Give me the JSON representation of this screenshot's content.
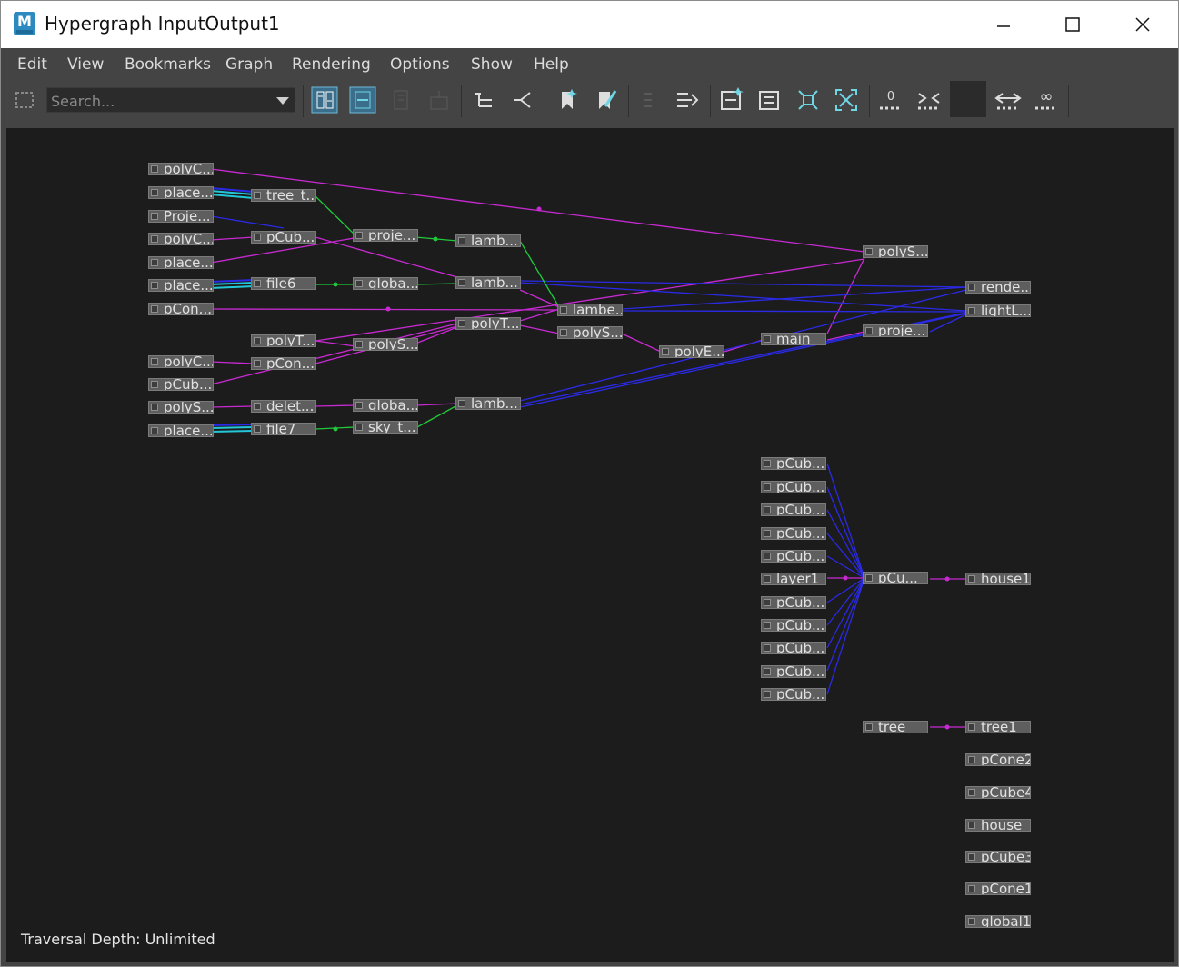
{
  "window": {
    "title": "Hypergraph InputOutput1",
    "app_icon_letter": "M",
    "controls": {
      "minimize": "—",
      "maximize": "☐",
      "close": "✕"
    }
  },
  "menu": [
    "Edit",
    "View",
    "Bookmarks",
    "Graph",
    "Rendering",
    "Options",
    "Show",
    "Help"
  ],
  "toolbar": {
    "search_placeholder": "Search...",
    "buttons": [
      "freeform-layout",
      "scene-hierarchy",
      "graph-layout",
      "hierarchy-layout",
      "input-connections",
      "output-connections",
      "create-bookmark",
      "edit-bookmark",
      "collapse",
      "expand",
      "frame-selection",
      "frame-branch",
      "frame-all",
      "frame-hierarchy",
      "depth-zero",
      "decrease-depth",
      "increase-depth",
      "unlimited-depth"
    ]
  },
  "graph": {
    "nodes": [
      {
        "id": "n1",
        "label": "polyC..."
      },
      {
        "id": "n2",
        "label": "place..."
      },
      {
        "id": "n3",
        "label": "tree_t..."
      },
      {
        "id": "n4",
        "label": "Proje..."
      },
      {
        "id": "n5",
        "label": "polyC..."
      },
      {
        "id": "n6",
        "label": "pCub..."
      },
      {
        "id": "n7",
        "label": "proje..."
      },
      {
        "id": "n8",
        "label": "lamb..."
      },
      {
        "id": "n9",
        "label": "place..."
      },
      {
        "id": "n10",
        "label": "polyS..."
      },
      {
        "id": "n11",
        "label": "place..."
      },
      {
        "id": "n12",
        "label": "file6"
      },
      {
        "id": "n13",
        "label": "globa..."
      },
      {
        "id": "n14",
        "label": "lamb..."
      },
      {
        "id": "n15",
        "label": "rende..."
      },
      {
        "id": "n16",
        "label": "pCon..."
      },
      {
        "id": "n17",
        "label": "lambe..."
      },
      {
        "id": "n18",
        "label": "lightL..."
      },
      {
        "id": "n19",
        "label": "polyT..."
      },
      {
        "id": "n20",
        "label": "polyT..."
      },
      {
        "id": "n21",
        "label": "polyS..."
      },
      {
        "id": "n22",
        "label": "main"
      },
      {
        "id": "n23",
        "label": "proje..."
      },
      {
        "id": "n24",
        "label": "polyS..."
      },
      {
        "id": "n25",
        "label": "polyE..."
      },
      {
        "id": "n26",
        "label": "polyC..."
      },
      {
        "id": "n27",
        "label": "pCon..."
      },
      {
        "id": "n28",
        "label": "pCub..."
      },
      {
        "id": "n29",
        "label": "polyS..."
      },
      {
        "id": "n30",
        "label": "delet..."
      },
      {
        "id": "n31",
        "label": "globa..."
      },
      {
        "id": "n32",
        "label": "lamb..."
      },
      {
        "id": "n33",
        "label": "place..."
      },
      {
        "id": "n34",
        "label": "file7"
      },
      {
        "id": "n35",
        "label": "sky_t..."
      },
      {
        "id": "p1",
        "label": "pCub..."
      },
      {
        "id": "p2",
        "label": "pCub..."
      },
      {
        "id": "p3",
        "label": "pCub..."
      },
      {
        "id": "p4",
        "label": "pCub..."
      },
      {
        "id": "p5",
        "label": "pCub..."
      },
      {
        "id": "p6",
        "label": "layer1"
      },
      {
        "id": "p7",
        "label": "pCub..."
      },
      {
        "id": "p8",
        "label": "pCub..."
      },
      {
        "id": "p9",
        "label": "pCub..."
      },
      {
        "id": "p10",
        "label": "pCub..."
      },
      {
        "id": "p11",
        "label": "pCub..."
      },
      {
        "id": "pc",
        "label": "pCu..."
      },
      {
        "id": "house1",
        "label": "house1"
      },
      {
        "id": "tree",
        "label": "tree"
      },
      {
        "id": "tree1",
        "label": "tree1"
      },
      {
        "id": "pCone2",
        "label": "pCone2"
      },
      {
        "id": "pCube4",
        "label": "pCube4"
      },
      {
        "id": "house",
        "label": "house"
      },
      {
        "id": "pCube3",
        "label": "pCube3"
      },
      {
        "id": "pCone1",
        "label": "pCone1"
      },
      {
        "id": "global1",
        "label": "global1"
      }
    ],
    "colors": {
      "magenta": "#c82ad2",
      "blue": "#2a2ae6",
      "green": "#22c83a",
      "cyan": "#22c8d8"
    }
  },
  "status": {
    "traversal_depth": "Traversal Depth: Unlimited"
  }
}
